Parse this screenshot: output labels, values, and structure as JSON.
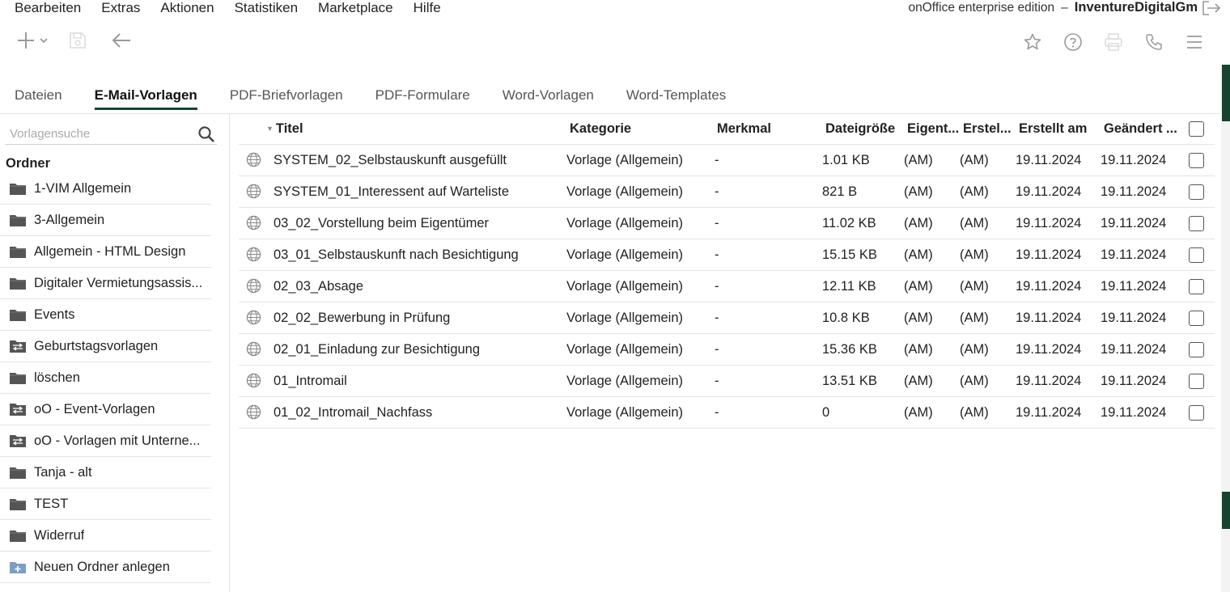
{
  "menu": {
    "items": [
      "Bearbeiten",
      "Extras",
      "Aktionen",
      "Statistiken",
      "Marketplace",
      "Hilfe"
    ]
  },
  "brand": {
    "edition": "onOffice enterprise edition",
    "separator": "–",
    "company": "InventureDigitalGm"
  },
  "toolbar": {
    "left_icons": [
      "plus-icon",
      "chevron-down-icon",
      "save-icon",
      "arrow-left-icon"
    ],
    "right_icons": [
      "star-icon",
      "help-icon",
      "print-icon",
      "phone-icon",
      "menu-icon"
    ]
  },
  "tabs": [
    {
      "label": "Dateien",
      "active": false
    },
    {
      "label": "E-Mail-Vorlagen",
      "active": true
    },
    {
      "label": "PDF-Briefvorlagen",
      "active": false
    },
    {
      "label": "PDF-Formulare",
      "active": false
    },
    {
      "label": "Word-Vorlagen",
      "active": false
    },
    {
      "label": "Word-Templates",
      "active": false
    }
  ],
  "sidebar": {
    "search_placeholder": "Vorlagensuche",
    "heading": "Ordner",
    "folders": [
      {
        "label": "1-VIM Allgemein",
        "icon": "folder-icon"
      },
      {
        "label": "3-Allgemein",
        "icon": "folder-icon"
      },
      {
        "label": "Allgemein - HTML Design",
        "icon": "folder-icon"
      },
      {
        "label": "Digitaler Vermietungsassis...",
        "icon": "folder-icon"
      },
      {
        "label": "Events",
        "icon": "folder-icon"
      },
      {
        "label": "Geburtstagsvorlagen",
        "icon": "shared-folder-icon"
      },
      {
        "label": "löschen",
        "icon": "folder-icon"
      },
      {
        "label": "oO - Event-Vorlagen",
        "icon": "shared-folder-icon"
      },
      {
        "label": "oO - Vorlagen mit Unterne...",
        "icon": "shared-folder-icon"
      },
      {
        "label": "Tanja - alt",
        "icon": "folder-icon"
      },
      {
        "label": "TEST",
        "icon": "folder-icon"
      },
      {
        "label": "Widerruf",
        "icon": "folder-icon"
      },
      {
        "label": "Neuen Ordner anlegen",
        "icon": "new-folder-icon"
      }
    ]
  },
  "table": {
    "columns": [
      "Titel",
      "Kategorie",
      "Merkmal",
      "Dateigröße",
      "Eigent...",
      "Erstel...",
      "Erstellt am",
      "Geändert ..."
    ],
    "rows": [
      {
        "titel": "SYSTEM_02_Selbstauskunft ausgefüllt",
        "kategorie": "Vorlage (Allgemein)",
        "merkmal": "-",
        "groesse": "1.01 KB",
        "eigentuemer": "(AM)",
        "ersteller": "(AM)",
        "erstellt": "19.11.2024",
        "geaendert": "19.11.2024"
      },
      {
        "titel": "SYSTEM_01_Interessent auf Warteliste",
        "kategorie": "Vorlage (Allgemein)",
        "merkmal": "-",
        "groesse": "821 B",
        "eigentuemer": "(AM)",
        "ersteller": "(AM)",
        "erstellt": "19.11.2024",
        "geaendert": "19.11.2024"
      },
      {
        "titel": "03_02_Vorstellung beim Eigentümer",
        "kategorie": "Vorlage (Allgemein)",
        "merkmal": "-",
        "groesse": "11.02 KB",
        "eigentuemer": "(AM)",
        "ersteller": "(AM)",
        "erstellt": "19.11.2024",
        "geaendert": "19.11.2024"
      },
      {
        "titel": "03_01_Selbstauskunft nach Besichtigung",
        "kategorie": "Vorlage (Allgemein)",
        "merkmal": "-",
        "groesse": "15.15 KB",
        "eigentuemer": "(AM)",
        "ersteller": "(AM)",
        "erstellt": "19.11.2024",
        "geaendert": "19.11.2024"
      },
      {
        "titel": "02_03_Absage",
        "kategorie": "Vorlage (Allgemein)",
        "merkmal": "-",
        "groesse": "12.11 KB",
        "eigentuemer": "(AM)",
        "ersteller": "(AM)",
        "erstellt": "19.11.2024",
        "geaendert": "19.11.2024"
      },
      {
        "titel": "02_02_Bewerbung in Prüfung",
        "kategorie": "Vorlage (Allgemein)",
        "merkmal": "-",
        "groesse": "10.8 KB",
        "eigentuemer": "(AM)",
        "ersteller": "(AM)",
        "erstellt": "19.11.2024",
        "geaendert": "19.11.2024"
      },
      {
        "titel": "02_01_Einladung zur Besichtigung",
        "kategorie": "Vorlage (Allgemein)",
        "merkmal": "-",
        "groesse": "15.36 KB",
        "eigentuemer": "(AM)",
        "ersteller": "(AM)",
        "erstellt": "19.11.2024",
        "geaendert": "19.11.2024"
      },
      {
        "titel": "01_Intromail",
        "kategorie": "Vorlage (Allgemein)",
        "merkmal": "-",
        "groesse": "13.51 KB",
        "eigentuemer": "(AM)",
        "ersteller": "(AM)",
        "erstellt": "19.11.2024",
        "geaendert": "19.11.2024"
      },
      {
        "titel": "01_02_Intromail_Nachfass",
        "kategorie": "Vorlage (Allgemein)",
        "merkmal": "-",
        "groesse": "0",
        "eigentuemer": "(AM)",
        "ersteller": "(AM)",
        "erstellt": "19.11.2024",
        "geaendert": "19.11.2024"
      }
    ]
  },
  "colors": {
    "accent": "#16452f",
    "text": "#222222",
    "muted": "#555555",
    "divider": "#e4e4e4",
    "icon": "#9a9a9a"
  }
}
